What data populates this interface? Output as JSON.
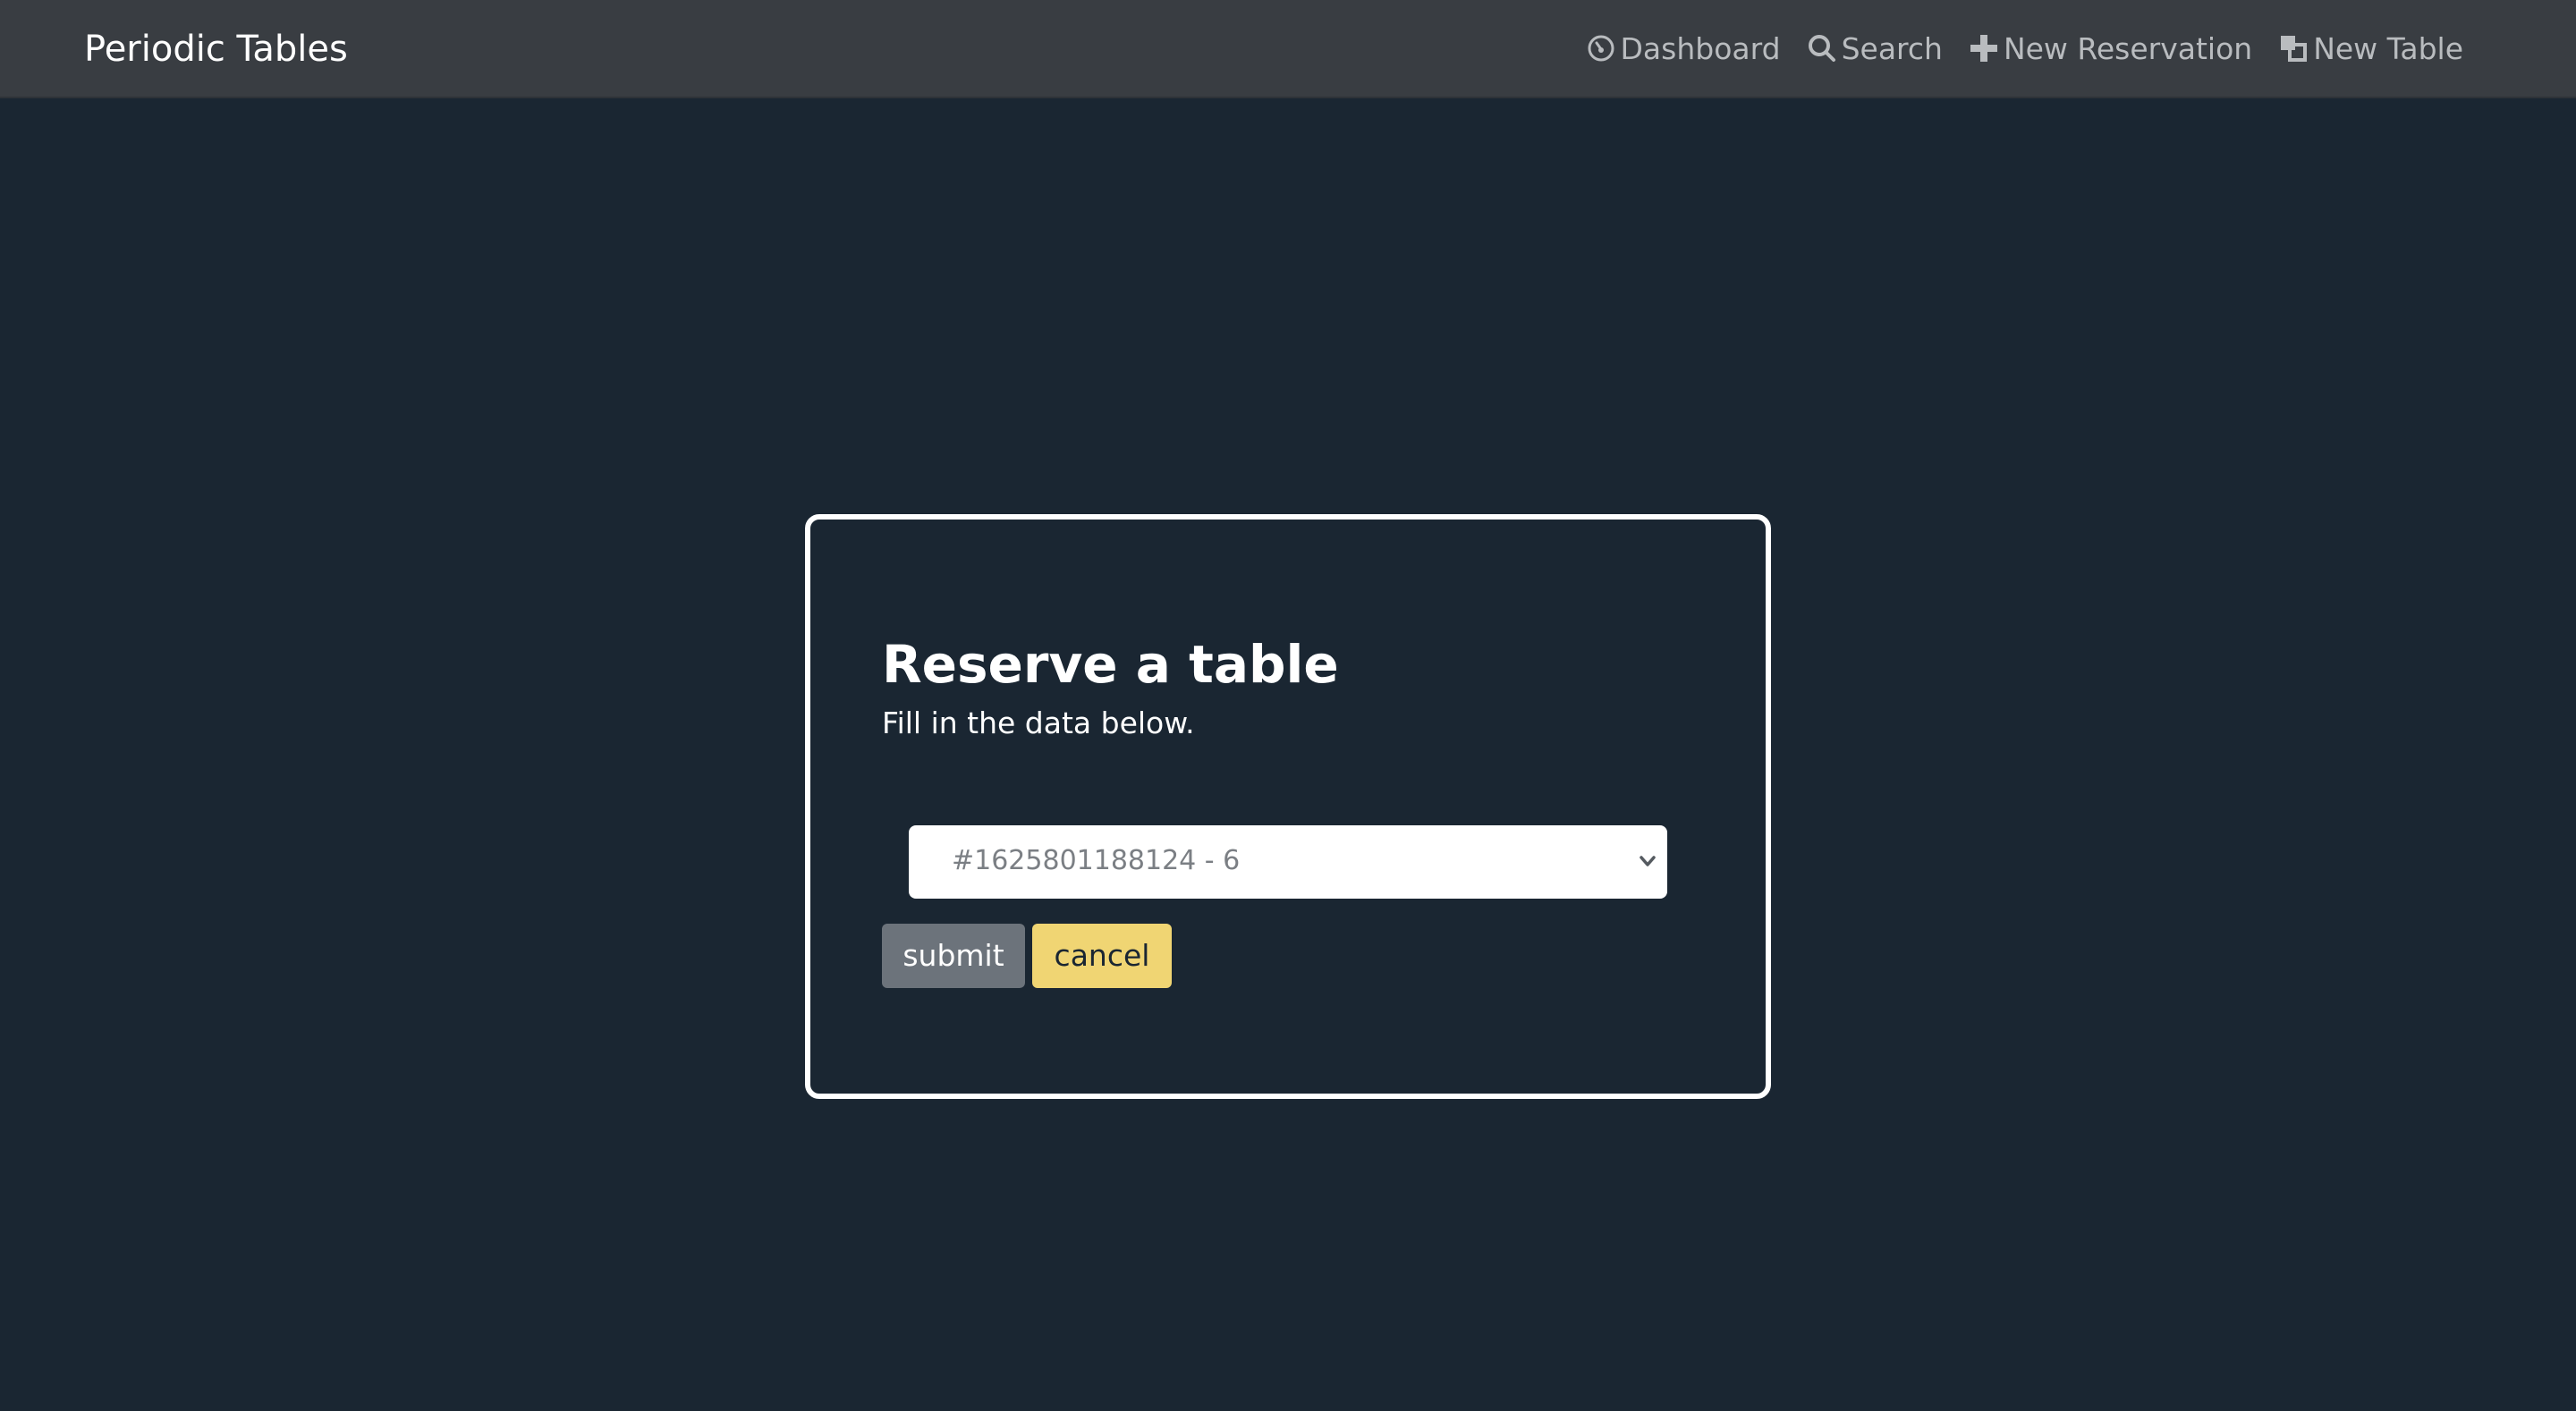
{
  "navbar": {
    "brand": "Periodic Tables",
    "links": [
      {
        "label": "Dashboard",
        "icon": "dashboard-gauge-icon"
      },
      {
        "label": "Search",
        "icon": "search-icon"
      },
      {
        "label": "New Reservation",
        "icon": "plus-icon"
      },
      {
        "label": "New Table",
        "icon": "layers-icon"
      }
    ]
  },
  "form": {
    "title": "Reserve a table",
    "subtitle": "Fill in the data below.",
    "table_select": {
      "selected": "#1625801188124 - 6"
    },
    "submit_label": "submit",
    "cancel_label": "cancel"
  },
  "colors": {
    "background": "#1a2632",
    "navbar": "#393d42",
    "submit": "#6c737b",
    "cancel": "#f0d573"
  }
}
